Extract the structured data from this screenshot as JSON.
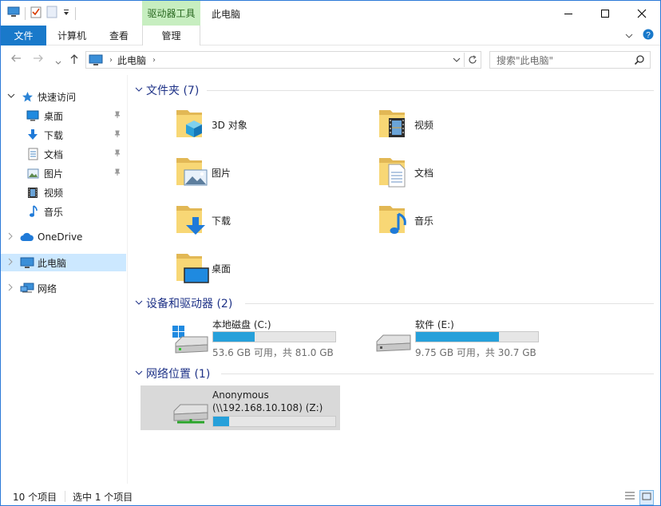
{
  "window": {
    "title": "此电脑",
    "context_tab_title": "驱动器工具"
  },
  "ribbon": {
    "tabs": [
      "文件",
      "计算机",
      "查看",
      "管理"
    ]
  },
  "address": {
    "path": "此电脑",
    "search_placeholder": "搜索\"此电脑\""
  },
  "sidebar": {
    "quick_access": "快速访问",
    "pinned": [
      {
        "label": "桌面",
        "icon": "desktop-icon",
        "pinned": true
      },
      {
        "label": "下载",
        "icon": "download-icon",
        "pinned": true
      },
      {
        "label": "文档",
        "icon": "document-icon",
        "pinned": true
      },
      {
        "label": "图片",
        "icon": "picture-icon",
        "pinned": true
      },
      {
        "label": "视频",
        "icon": "video-icon",
        "pinned": false
      },
      {
        "label": "音乐",
        "icon": "music-icon",
        "pinned": false
      }
    ],
    "onedrive": "OneDrive",
    "this_pc": "此电脑",
    "network": "网络"
  },
  "groups": {
    "folders": {
      "title": "文件夹 (7)",
      "items": [
        "3D 对象",
        "视频",
        "图片",
        "文档",
        "下载",
        "音乐",
        "桌面"
      ]
    },
    "drives": {
      "title": "设备和驱动器 (2)",
      "items": [
        {
          "name": "本地磁盘 (C:)",
          "size": "53.6 GB 可用，共 81.0 GB",
          "used_fraction": 0.34
        },
        {
          "name": "软件 (E:)",
          "size": "9.75 GB 可用，共 30.7 GB",
          "used_fraction": 0.68
        }
      ]
    },
    "network": {
      "title": "网络位置 (1)",
      "item": {
        "name": "Anonymous",
        "path": "(\\\\192.168.10.108) (Z:)",
        "used_fraction": 0.13
      }
    }
  },
  "status": {
    "count": "10 个项目",
    "selected": "选中 1 个项目"
  },
  "colors": {
    "accent": "#1979ca",
    "context_tab": "#c7eec0",
    "selection": "#cce8ff",
    "bar_fill": "#26a0da",
    "group_title": "#1e3287"
  }
}
